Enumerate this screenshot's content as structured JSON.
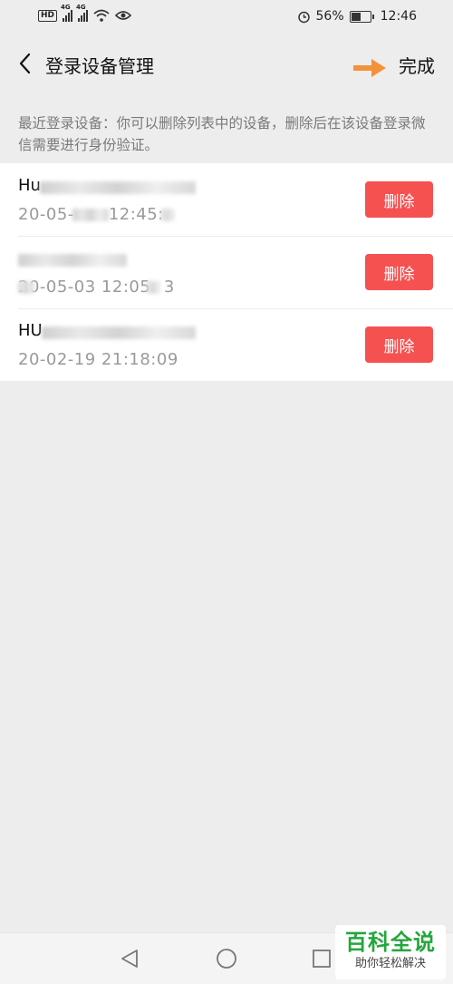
{
  "status_bar": {
    "hd_badge": "HD",
    "network_1": "4G",
    "network_2": "4G",
    "battery_percent": "56%",
    "battery_level": 0.56,
    "time": "12:46",
    "icons": [
      "hd-icon",
      "signal-icon",
      "signal-icon",
      "wifi-icon",
      "eye-icon",
      "alarm-icon",
      "battery-icon"
    ]
  },
  "header": {
    "title": "登录设备管理",
    "done_label": "完成",
    "back_icon": "chevron-left-icon",
    "annotation_arrow": "orange-arrow-icon",
    "accent_color": "#f3923a"
  },
  "hint": "最近登录设备：你可以删除列表中的设备，删除后在该设备登录微信需要进行身份验证。",
  "devices": [
    {
      "name_visible": "Hu",
      "time": "20-05-",
      "time_tail": "12:45:",
      "delete_label": "删除"
    },
    {
      "name_visible": "",
      "time": "20-05-03 12:05:",
      "time_tail": "3",
      "delete_label": "删除"
    },
    {
      "name_visible": "HU",
      "time": "20-02-19 21:18:09",
      "time_tail": "",
      "delete_label": "删除"
    }
  ],
  "delete_color": "#f55150",
  "system_nav": {
    "icons": [
      "back-triangle-icon",
      "home-circle-icon",
      "recents-square-icon"
    ]
  },
  "watermark": {
    "main": "百科全说",
    "sub": "助你轻松解决",
    "color": "#25a63c"
  }
}
